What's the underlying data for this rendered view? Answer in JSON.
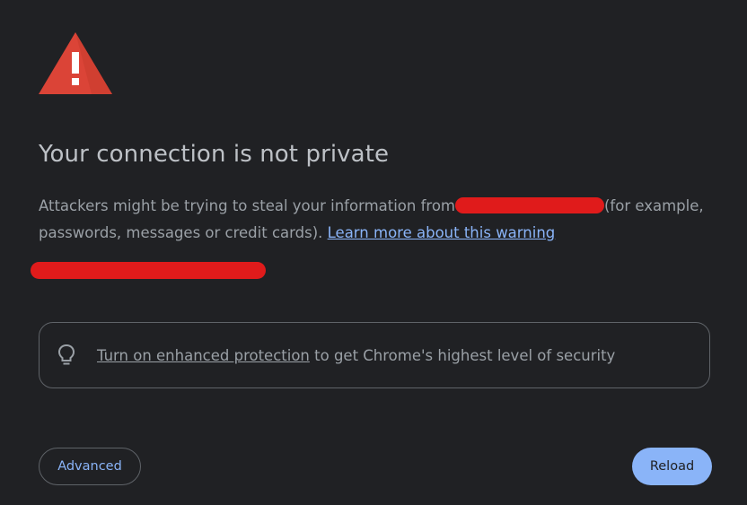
{
  "page": {
    "title": "Your connection is not private",
    "message_part1": "Attackers might be trying to steal your information from",
    "message_part2": "(for example, passwords, messages or credit cards).",
    "learn_more_link": "Learn more about this warning"
  },
  "enhanced_protection": {
    "link_text": "Turn on enhanced protection",
    "rest_text": " to get Chrome's highest level of security",
    "icon": "lightbulb-icon"
  },
  "buttons": {
    "advanced": "Advanced",
    "reload": "Reload"
  },
  "icons": {
    "warning": "warning-triangle-icon"
  },
  "colors": {
    "background": "#202124",
    "warning_red": "#db4437",
    "link_blue": "#8ab4f8",
    "redaction": "#e01b1b"
  }
}
